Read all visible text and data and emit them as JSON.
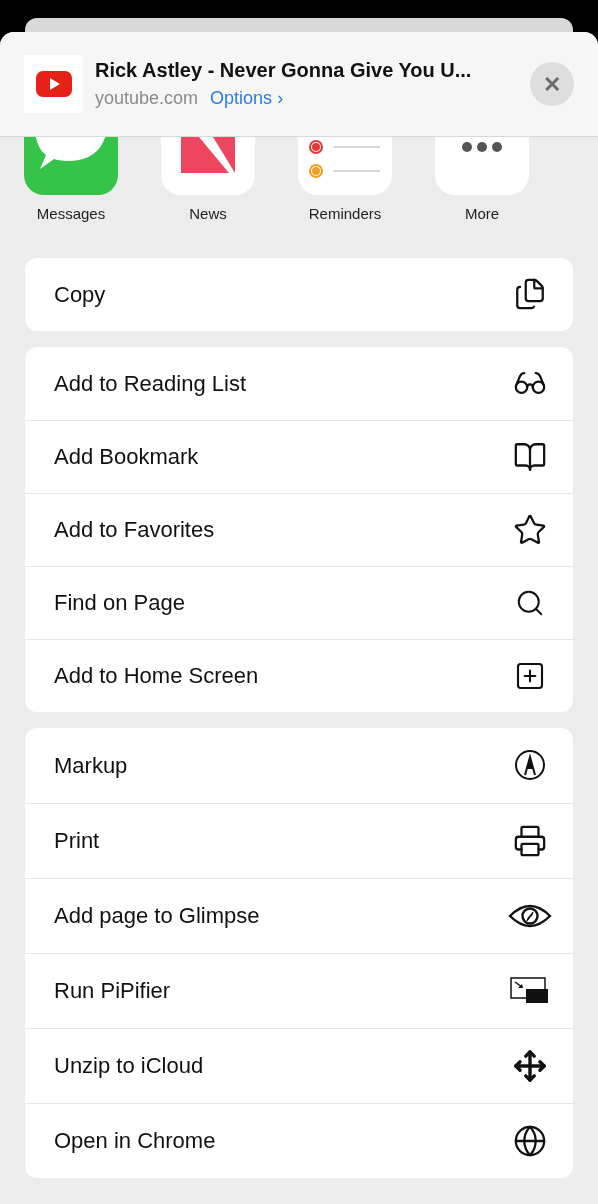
{
  "header": {
    "title": "Rick Astley - Never Gonna Give You U...",
    "domain": "youtube.com",
    "options": "Options",
    "chevron": "›",
    "close": "✕"
  },
  "apps": [
    {
      "label": "Messages"
    },
    {
      "label": "News"
    },
    {
      "label": "Reminders"
    },
    {
      "label": "More"
    }
  ],
  "action_groups": [
    {
      "actions": [
        {
          "label": "Copy"
        }
      ]
    },
    {
      "actions": [
        {
          "label": "Add to Reading List"
        },
        {
          "label": "Add Bookmark"
        },
        {
          "label": "Add to Favorites"
        },
        {
          "label": "Find on Page"
        },
        {
          "label": "Add to Home Screen"
        }
      ]
    },
    {
      "actions": [
        {
          "label": "Markup"
        },
        {
          "label": "Print"
        },
        {
          "label": "Add page to Glimpse"
        },
        {
          "label": "Run PiPifier"
        },
        {
          "label": "Unzip to iCloud"
        },
        {
          "label": "Open in Chrome"
        }
      ]
    }
  ]
}
